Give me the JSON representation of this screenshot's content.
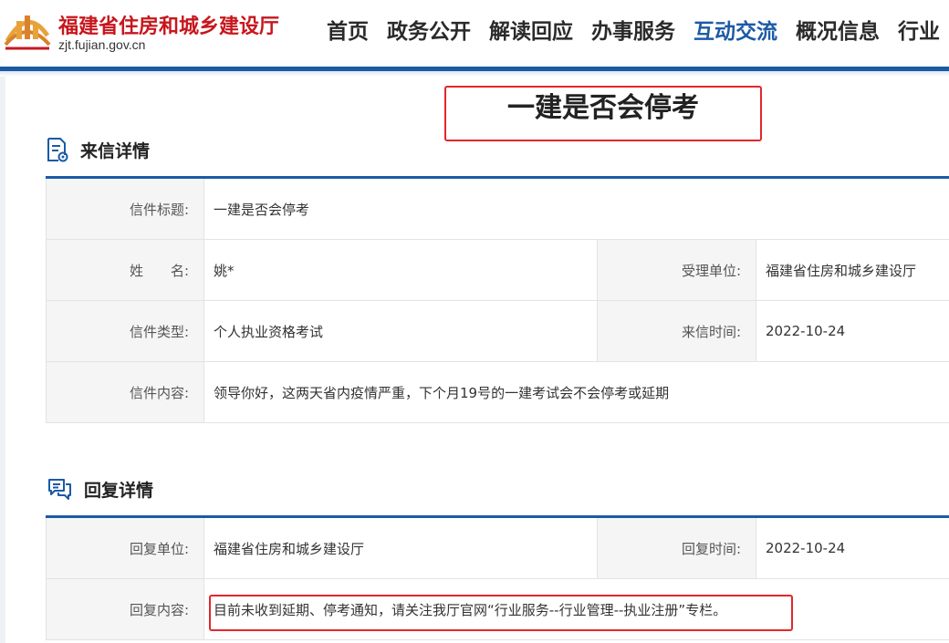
{
  "header": {
    "site_name": "福建省住房和城乡建设厅",
    "site_url": "zjt.fujian.gov.cn",
    "nav": [
      {
        "label": "首页"
      },
      {
        "label": "政务公开"
      },
      {
        "label": "解读回应"
      },
      {
        "label": "办事服务"
      },
      {
        "label": "互动交流"
      },
      {
        "label": "概况信息"
      },
      {
        "label": "行业"
      }
    ],
    "active_nav": "互动交流"
  },
  "page": {
    "title": "一建是否会停考"
  },
  "letter": {
    "heading": "来信详情",
    "subject_label": "信件标题:",
    "subject": "一建是否会停考",
    "name_label": "姓　　名:",
    "name": "姚*",
    "dept_label": "受理单位:",
    "dept": "福建省住房和城乡建设厅",
    "type_label": "信件类型:",
    "type": "个人执业资格考试",
    "time_label": "来信时间:",
    "time": "2022-10-24",
    "content_label": "信件内容:",
    "content": "领导你好，这两天省内疫情严重，下个月19号的一建考试会不会停考或延期"
  },
  "reply": {
    "heading": "回复详情",
    "unit_label": "回复单位:",
    "unit": "福建省住房和城乡建设厅",
    "time_label": "回复时间:",
    "time": "2022-10-24",
    "content_label": "回复内容:",
    "content": "目前未收到延期、停考通知，请关注我厅官网“行业服务--行业管理--执业注册”专栏。"
  },
  "colors": {
    "brand_blue": "#1b5aa6",
    "logo_red": "#c8161d",
    "highlight_red": "#e3262b"
  }
}
